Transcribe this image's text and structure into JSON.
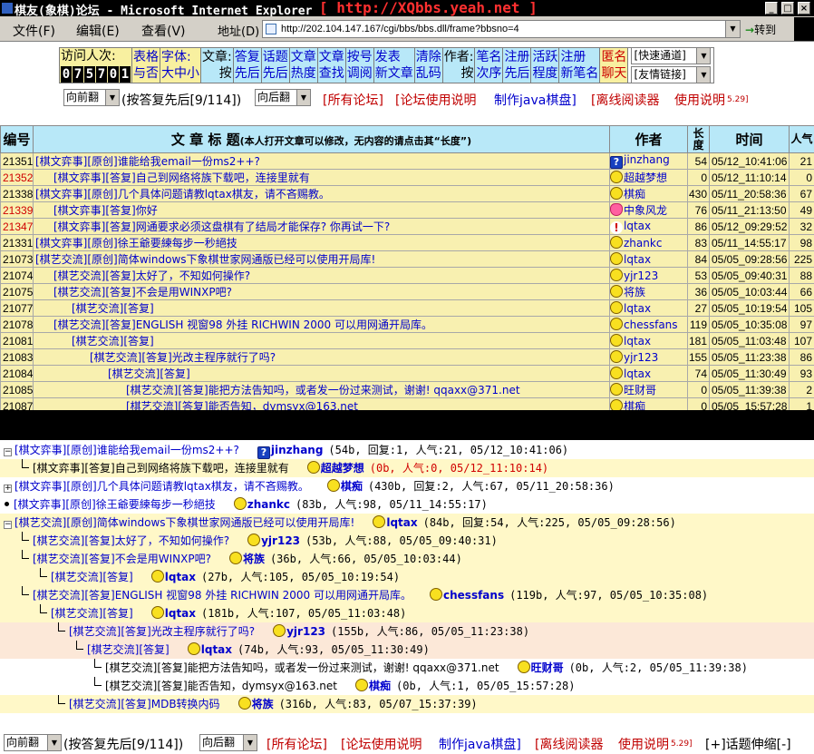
{
  "window": {
    "title": "棋友(象棋)论坛 - Microsoft Internet Explorer",
    "title_url": "[ http://XQbbs.yeah.net ]"
  },
  "menu": {
    "file": "文件(F)",
    "edit": "编辑(E)",
    "view": "查看(V)",
    "address_label": "地址(D)",
    "address_value": "http://202.104.147.167/cgi/bbs/bbs.dll/frame?bbsno=4",
    "go_label": "转到"
  },
  "toolbar": {
    "visitors_label": "访问人次:",
    "visitor_digits": [
      "0",
      "7",
      "5",
      "7",
      "0",
      "1"
    ],
    "table_grid": [
      "表格",
      "与否"
    ],
    "font": [
      "字体:",
      "大中小"
    ],
    "article_sort": [
      "文章:",
      "按"
    ],
    "by_reply": [
      "答复",
      "先后"
    ],
    "by_topic": [
      "话题",
      "先后"
    ],
    "by_popularity": [
      "文章",
      "热度"
    ],
    "search": [
      "文章",
      "查找"
    ],
    "by_account": [
      "按号",
      "调阅"
    ],
    "new_post": [
      "发表",
      "新文章"
    ],
    "clear_garbled": [
      "清除",
      "乱码"
    ],
    "author_sort": [
      "作者:",
      "按"
    ],
    "by_name": [
      "笔名",
      "次序"
    ],
    "by_registration": [
      "注册",
      "先后"
    ],
    "by_activity": [
      "活跃",
      "程度"
    ],
    "new_registrations": [
      "注册",
      "新笔名"
    ],
    "anon_chat": [
      "匿名",
      "聊天"
    ],
    "quick_channel": "[快速通道]",
    "friendly_links": "[友情链接]"
  },
  "nav": {
    "prev_select": "向前翻",
    "order_info": "(按答复先后[9/114])",
    "next_select": "向后翻",
    "all_forums": "[所有论坛]",
    "forum_help": "[论坛使用说明",
    "java_board": "制作java棋盘]",
    "offline_reader": "[离线阅读器",
    "usage": "使用说明",
    "usage_date": "5.29]",
    "toggle_tree": "[+]话题伸缩[-]"
  },
  "table": {
    "headers": {
      "id": "编号",
      "title": "文 章 标 题",
      "title_note": "(本人打开文章可以修改，无内容的请点击其“长度”)",
      "author": "作者",
      "length": "长度",
      "time": "时间",
      "hits": "人气"
    },
    "rows": [
      {
        "id": "21351",
        "id_red": false,
        "indent": 0,
        "title": "[棋文弈事][原创]谁能给我email一份ms2++?",
        "icon": "q",
        "author": "jinzhang",
        "len": "54",
        "time": "05/12_10:41:06",
        "hits": "21"
      },
      {
        "id": "21352",
        "id_red": true,
        "indent": 1,
        "title": "[棋文弈事][答复]自己到网络将族下载吧，连接里就有",
        "icon": "face",
        "author": "超越梦想",
        "len": "0",
        "time": "05/12_11:10:14",
        "hits": "0"
      },
      {
        "id": "21338",
        "id_red": false,
        "indent": 0,
        "title": "[棋文弈事][原创]几个具体问题请教lqtax棋友，请不吝赐教。",
        "icon": "face",
        "author": "棋痴",
        "len": "430",
        "time": "05/11_20:58:36",
        "hits": "67"
      },
      {
        "id": "21339",
        "id_red": true,
        "indent": 1,
        "title": "[棋文弈事][答复]你好",
        "icon": "heart",
        "author": "中象风龙",
        "len": "76",
        "time": "05/11_21:13:50",
        "hits": "49"
      },
      {
        "id": "21347",
        "id_red": true,
        "indent": 1,
        "title": "[棋文弈事][答复]网通要求必须这盘棋有了结局才能保存? 你再试一下?",
        "icon": "excl",
        "author": "lqtax",
        "len": "86",
        "time": "05/12_09:29:52",
        "hits": "32"
      },
      {
        "id": "21331",
        "id_red": false,
        "indent": 0,
        "title": "[棋文弈事][原创]徐王爺要練每步一秒絕技",
        "icon": "face",
        "author": "zhankc",
        "len": "83",
        "time": "05/11_14:55:17",
        "hits": "98"
      },
      {
        "id": "21073",
        "id_red": false,
        "indent": 0,
        "title": "[棋艺交流][原创]简体windows下象棋世家网通版已经可以使用开局库!",
        "icon": "face",
        "author": "lqtax",
        "len": "84",
        "time": "05/05_09:28:56",
        "hits": "225"
      },
      {
        "id": "21074",
        "id_red": false,
        "indent": 1,
        "title": "[棋艺交流][答复]太好了，不知如何操作?",
        "icon": "face",
        "author": "yjr123",
        "len": "53",
        "time": "05/05_09:40:31",
        "hits": "88"
      },
      {
        "id": "21075",
        "id_red": false,
        "indent": 1,
        "title": "[棋艺交流][答复]不会是用WINXP吧?",
        "icon": "face",
        "author": "将族",
        "len": "36",
        "time": "05/05_10:03:44",
        "hits": "66"
      },
      {
        "id": "21077",
        "id_red": false,
        "indent": 2,
        "title": "[棋艺交流][答复]",
        "icon": "face",
        "author": "lqtax",
        "len": "27",
        "time": "05/05_10:19:54",
        "hits": "105"
      },
      {
        "id": "21078",
        "id_red": false,
        "indent": 1,
        "title": "[棋艺交流][答复]ENGLISH 视窗98 外挂 RICHWIN 2000 可以用网通开局库。",
        "icon": "face",
        "author": "chessfans",
        "len": "119",
        "time": "05/05_10:35:08",
        "hits": "97"
      },
      {
        "id": "21081",
        "id_red": false,
        "indent": 2,
        "title": "[棋艺交流][答复]",
        "icon": "face",
        "author": "lqtax",
        "len": "181",
        "time": "05/05_11:03:48",
        "hits": "107"
      },
      {
        "id": "21083",
        "id_red": false,
        "indent": 3,
        "title": "[棋艺交流][答复]光改主程序就行了吗?",
        "icon": "face",
        "author": "yjr123",
        "len": "155",
        "time": "05/05_11:23:38",
        "hits": "86"
      },
      {
        "id": "21084",
        "id_red": false,
        "indent": 4,
        "title": "[棋艺交流][答复]",
        "icon": "face",
        "author": "lqtax",
        "len": "74",
        "time": "05/05_11:30:49",
        "hits": "93"
      },
      {
        "id": "21085",
        "id_red": false,
        "indent": 5,
        "title": "[棋艺交流][答复]能把方法告知吗，或者发一份过来测试，谢谢! qqaxx@371.net",
        "icon": "face",
        "author": "旺财哥",
        "len": "0",
        "time": "05/05_11:39:38",
        "hits": "2"
      },
      {
        "id": "21087",
        "id_red": false,
        "indent": 5,
        "title": "[棋艺交流][答复]能否告知，dymsyx@163.net",
        "icon": "face",
        "author": "棋痴",
        "len": "0",
        "time": "05/05_15:57:28",
        "hits": "1"
      }
    ]
  },
  "tree": [
    {
      "bg": "#ffffff",
      "prefix": "minus",
      "indent": 0,
      "title": "[棋文弈事][原创]谁能给我email一份ms2++?",
      "icon": "q",
      "author": "jinzhang",
      "meta": "(54b, 回复:1, 人气:21, 05/12_10:41:06)",
      "red": false
    },
    {
      "bg": "#fff8c8",
      "prefix": "elbow",
      "indent": 1,
      "title": "[棋文弈事][答复]自己到网络将族下载吧，连接里就有",
      "icon": "face",
      "author": "超越梦想",
      "meta": "(0b, 人气:0, 05/12_11:10:14)",
      "red": true,
      "dark": true
    },
    {
      "bg": "#ffffff",
      "prefix": "plus",
      "indent": 0,
      "title": "[棋文弈事][原创]几个具体问题请教lqtax棋友，请不吝赐教。",
      "icon": "face",
      "author": "棋痴",
      "meta": "(430b, 回复:2, 人气:67, 05/11_20:58:36)",
      "red": false
    },
    {
      "bg": "#ffffff",
      "prefix": "dot",
      "indent": 0,
      "title": "[棋文弈事][原创]徐王爺要練每步一秒絕技",
      "icon": "face",
      "author": "zhankc",
      "meta": "(83b, 人气:98, 05/11_14:55:17)",
      "red": false
    },
    {
      "bg": "#fff8c8",
      "prefix": "minus",
      "indent": 0,
      "title": "[棋艺交流][原创]简体windows下象棋世家网通版已经可以使用开局库!",
      "icon": "face",
      "author": "lqtax",
      "meta": "(84b, 回复:54, 人气:225, 05/05_09:28:56)",
      "red": false
    },
    {
      "bg": "#fff8c8",
      "prefix": "elbow",
      "indent": 1,
      "title": "[棋艺交流][答复]太好了，不知如何操作?",
      "icon": "face",
      "author": "yjr123",
      "meta": "(53b, 人气:88, 05/05_09:40:31)",
      "red": false
    },
    {
      "bg": "#fff8c8",
      "prefix": "elbow",
      "indent": 1,
      "title": "[棋艺交流][答复]不会是用WINXP吧?",
      "icon": "face",
      "author": "将族",
      "meta": "(36b, 人气:66, 05/05_10:03:44)",
      "red": false
    },
    {
      "bg": "#fff8c8",
      "prefix": "elbow",
      "indent": 2,
      "title": "[棋艺交流][答复]",
      "icon": "face",
      "author": "lqtax",
      "meta": "(27b, 人气:105, 05/05_10:19:54)",
      "red": false
    },
    {
      "bg": "#fff8c8",
      "prefix": "elbow",
      "indent": 1,
      "title": "[棋艺交流][答复]ENGLISH 视窗98 外挂 RICHWIN 2000 可以用网通开局库。",
      "icon": "face",
      "author": "chessfans",
      "meta": "(119b, 人气:97, 05/05_10:35:08)",
      "red": false
    },
    {
      "bg": "#fff8c8",
      "prefix": "elbow",
      "indent": 2,
      "title": "[棋艺交流][答复]",
      "icon": "face",
      "author": "lqtax",
      "meta": "(181b, 人气:107, 05/05_11:03:48)",
      "red": false
    },
    {
      "bg": "#fce8d8",
      "prefix": "elbow",
      "indent": 3,
      "title": "[棋艺交流][答复]光改主程序就行了吗?",
      "icon": "face",
      "author": "yjr123",
      "meta": "(155b, 人气:86, 05/05_11:23:38)",
      "red": false
    },
    {
      "bg": "#fce8d8",
      "prefix": "elbow",
      "indent": 4,
      "title": "[棋艺交流][答复]",
      "icon": "face",
      "author": "lqtax",
      "meta": "(74b, 人气:93, 05/05_11:30:49)",
      "red": false
    },
    {
      "bg": "#ffffff",
      "prefix": "elbow",
      "indent": 5,
      "title": "[棋艺交流][答复]能把方法告知吗，或者发一份过来测试，谢谢! qqaxx@371.net",
      "icon": "face",
      "author": "旺财哥",
      "meta": "(0b, 人气:2, 05/05_11:39:38)",
      "red": false,
      "dark": true
    },
    {
      "bg": "#ffffff",
      "prefix": "elbow",
      "indent": 5,
      "title": "[棋艺交流][答复]能否告知，dymsyx@163.net",
      "icon": "face",
      "author": "棋痴",
      "meta": "(0b, 人气:1, 05/05_15:57:28)",
      "red": false,
      "dark": true
    },
    {
      "bg": "#fff8c8",
      "prefix": "elbow",
      "indent": 3,
      "title": "[棋艺交流][答复]MDB转换内码",
      "icon": "face",
      "author": "将族",
      "meta": "(316b, 人气:83, 05/07_15:37:39)",
      "red": false
    }
  ],
  "colors": {
    "toolbar_bg": "#b8e8f8",
    "toolbar_yellow": "#f8f0a0",
    "row_bg": "#f8f0b0",
    "link_blue": "#0000cc",
    "accent_red": "#c00000"
  }
}
